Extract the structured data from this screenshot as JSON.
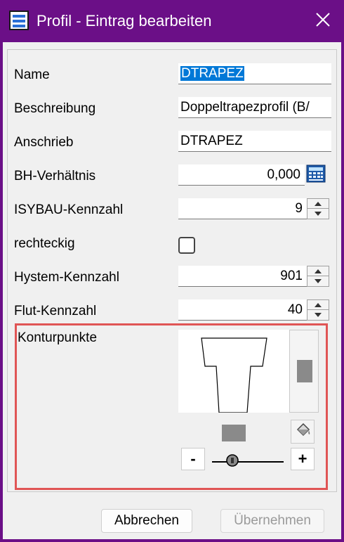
{
  "window": {
    "title": "Profil - Eintrag bearbeiten"
  },
  "fields": {
    "name": {
      "label": "Name",
      "value": "DTRAPEZ"
    },
    "beschreibung": {
      "label": "Beschreibung",
      "value": "Doppeltrapezprofil (B/"
    },
    "anschrieb": {
      "label": "Anschrieb",
      "value": "DTRAPEZ"
    },
    "bh": {
      "label": "BH-Verhältnis",
      "value": "0,000"
    },
    "isybau": {
      "label": "ISYBAU-Kennzahl",
      "value": "9"
    },
    "rechteckig": {
      "label": "rechteckig",
      "checked": false
    },
    "hystem": {
      "label": "Hystem-Kennzahl",
      "value": "901"
    },
    "flut": {
      "label": "Flut-Kennzahl",
      "value": "40"
    },
    "kontur": {
      "label": "Konturpunkte"
    }
  },
  "zoom": {
    "minus": "-",
    "plus": "+"
  },
  "buttons": {
    "cancel": "Abbrechen",
    "apply": "Übernehmen"
  },
  "icons": {
    "app": "app-list-icon",
    "close": "close-icon",
    "calc": "calculator-icon",
    "fill": "paint-bucket-icon",
    "zoom_thumb": "zoom-slider-icon"
  },
  "colors": {
    "titlebar": "#6b0f87",
    "selection": "#0078d7",
    "highlight": "#e05555"
  }
}
